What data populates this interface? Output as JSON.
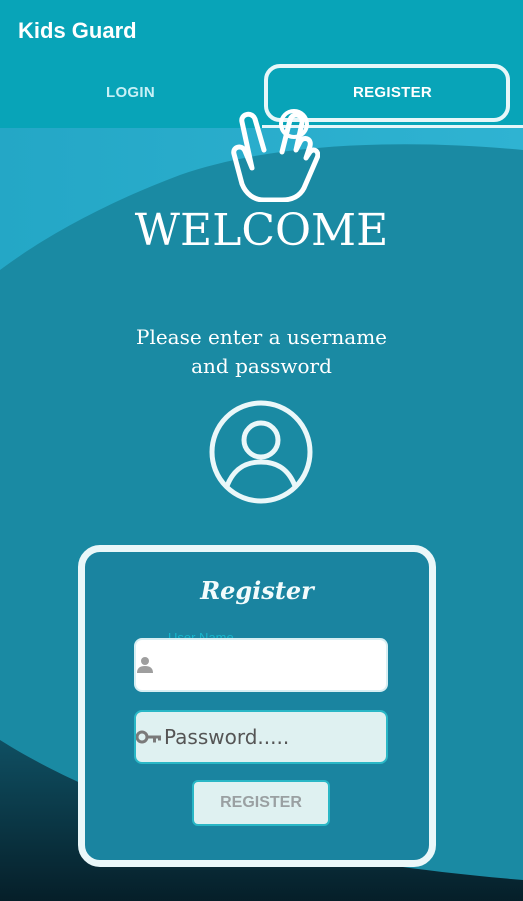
{
  "app": {
    "title": "Kids Guard"
  },
  "tabs": {
    "login_label": "LOGIN",
    "register_label": "REGISTER"
  },
  "main": {
    "welcome": "WELCOME",
    "prompt_line1": "Please enter a username",
    "prompt_line2": "and password"
  },
  "form": {
    "title": "Register",
    "username_label": "User Name.....",
    "username_value": "",
    "password_placeholder": "Password.....",
    "password_value": "",
    "submit_label": "REGISTER"
  },
  "icons": {
    "avatar": "user-circle-icon",
    "user": "person-icon",
    "key": "key-icon",
    "pointer": "hand-pointer-icon"
  },
  "colors": {
    "appbar": "#08a4b8",
    "background": "#1d8aa3",
    "accent": "#2ab7c6",
    "dark_wave": "#082f3c"
  }
}
